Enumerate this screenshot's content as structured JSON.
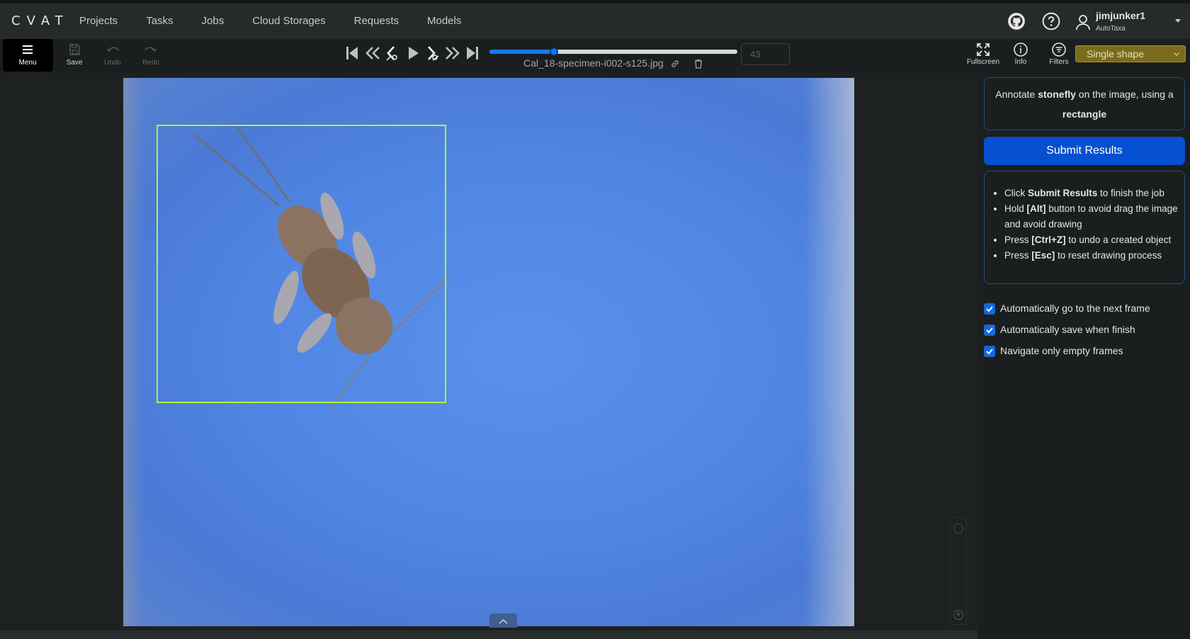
{
  "app": {
    "logo": "CVAT"
  },
  "nav": {
    "links": [
      "Projects",
      "Tasks",
      "Jobs",
      "Cloud Storages",
      "Requests",
      "Models"
    ],
    "user": {
      "name": "jimjunker1",
      "org": "AutoTaxa"
    }
  },
  "toolbar": {
    "menu_label": "Menu",
    "save_label": "Save",
    "undo_label": "Undo",
    "redo_label": "Redo",
    "filename": "Cal_18-specimen-i002-s125.jpg",
    "frame_value": "43",
    "progress_fraction": 0.26,
    "fullscreen_label": "Fullscreen",
    "info_label": "Info",
    "filters_label": "Filters",
    "shape_mode": "Single shape"
  },
  "sidebar": {
    "instruction": {
      "prefix": "Annotate ",
      "label": "stonefly",
      "middle": " on the image, using a ",
      "shape": "rectangle"
    },
    "submit_label": "Submit Results",
    "tips": [
      {
        "pre": "Click ",
        "bold": "Submit Results",
        "post": " to finish the job"
      },
      {
        "pre": "Hold ",
        "bold": "[Alt]",
        "post": " button to avoid drag the image and avoid drawing"
      },
      {
        "pre": "Press ",
        "bold": "[Ctrl+Z]",
        "post": " to undo a created object"
      },
      {
        "pre": "Press ",
        "bold": "[Esc]",
        "post": " to reset drawing process"
      }
    ],
    "options": [
      {
        "label": "Automatically go to the next frame",
        "checked": true
      },
      {
        "label": "Automatically save when finish",
        "checked": true
      },
      {
        "label": "Navigate only empty frames",
        "checked": true
      }
    ]
  },
  "colors": {
    "accent": "#0550d0",
    "bbox": "#b6f03a",
    "shape_mode_bg": "#7a6c1c"
  }
}
